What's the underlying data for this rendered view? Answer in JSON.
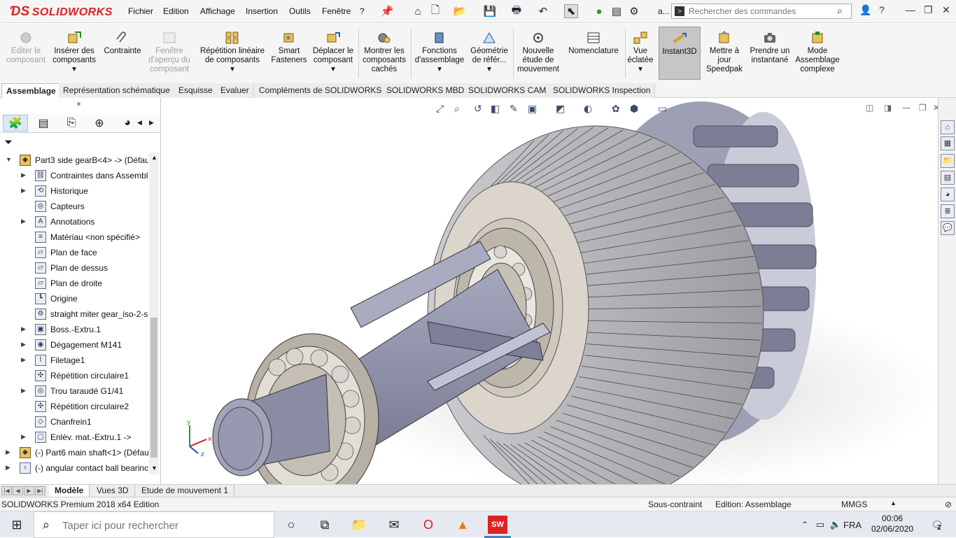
{
  "app": {
    "brand": "SOLIDWORKS",
    "menu": [
      "Fichier",
      "Edition",
      "Affichage",
      "Insertion",
      "Outils",
      "Fenêtre",
      "?"
    ],
    "overflow_label": "a...",
    "search_placeholder": "Rechercher des commandes"
  },
  "ribbon": {
    "buttons": [
      {
        "id": "edit-component",
        "label": "Editer le composant",
        "icon": "edit-component-icon",
        "enabled": false
      },
      {
        "id": "insert-components",
        "label": "Insérer des composants",
        "icon": "insert-components-icon",
        "enabled": true,
        "dropdown": true
      },
      {
        "id": "mate",
        "label": "Contrainte",
        "icon": "paperclip-icon",
        "enabled": true
      },
      {
        "id": "preview-window",
        "label": "Fenêtre d'aperçu du composant",
        "icon": "preview-window-icon",
        "enabled": false
      },
      {
        "id": "linear-pattern",
        "label": "Répétition linéaire de composants",
        "icon": "linear-pattern-icon",
        "enabled": true,
        "dropdown": true
      },
      {
        "id": "smart-fasteners",
        "label": "Smart Fasteners",
        "icon": "smart-fasteners-icon",
        "enabled": true
      },
      {
        "id": "move-component",
        "label": "Déplacer le composant",
        "icon": "move-component-icon",
        "enabled": true,
        "dropdown": true
      },
      {
        "id": "show-hidden",
        "label": "Montrer les composants cachés",
        "icon": "show-hidden-icon",
        "enabled": true
      },
      {
        "id": "assembly-features",
        "label": "Fonctions d'assemblage",
        "icon": "assembly-features-icon",
        "enabled": true,
        "dropdown": true
      },
      {
        "id": "reference-geometry",
        "label": "Géométrie de référ...",
        "icon": "reference-geometry-icon",
        "enabled": true,
        "dropdown": true
      },
      {
        "id": "new-motion-study",
        "label": "Nouvelle étude de mouvement",
        "icon": "motion-study-icon",
        "enabled": true
      },
      {
        "id": "bom",
        "label": "Nomenclature",
        "icon": "bom-icon",
        "enabled": true
      },
      {
        "id": "exploded-view",
        "label": "Vue éclatée",
        "icon": "exploded-view-icon",
        "enabled": true,
        "dropdown": true
      },
      {
        "id": "instant3d",
        "label": "Instant3D",
        "icon": "instant3d-icon",
        "enabled": true,
        "active": true
      },
      {
        "id": "update-speedpak",
        "label": "Mettre à jour Speedpak",
        "icon": "speedpak-icon",
        "enabled": true
      },
      {
        "id": "snapshot",
        "label": "Prendre un instantané",
        "icon": "camera-icon",
        "enabled": true
      },
      {
        "id": "large-assembly",
        "label": "Mode Assemblage complexe",
        "icon": "large-assembly-icon",
        "enabled": true
      }
    ]
  },
  "command_tabs": [
    {
      "label": "Assemblage",
      "active": true
    },
    {
      "label": "Représentation schématique"
    },
    {
      "label": "Esquisse"
    },
    {
      "label": "Evaluer"
    },
    {
      "label": "Compléments de SOLIDWORKS"
    },
    {
      "label": "SOLIDWORKS MBD"
    },
    {
      "label": "SOLIDWORKS CAM"
    },
    {
      "label": "SOLIDWORKS Inspection"
    }
  ],
  "feature_tree": [
    {
      "label": "Part3 side gearB<4> -> (Défau",
      "indent": 0,
      "expanded": true,
      "icon": "part-icon"
    },
    {
      "label": "Contraintes dans Assembl",
      "indent": 1,
      "expandable": true,
      "icon": "mates-icon"
    },
    {
      "label": "Historique",
      "indent": 1,
      "expandable": true,
      "icon": "history-icon"
    },
    {
      "label": "Capteurs",
      "indent": 1,
      "icon": "sensor-icon"
    },
    {
      "label": "Annotations",
      "indent": 1,
      "expandable": true,
      "icon": "annotations-icon"
    },
    {
      "label": "Matériau <non spécifié>",
      "indent": 1,
      "icon": "material-icon"
    },
    {
      "label": "Plan de face",
      "indent": 1,
      "icon": "plane-icon"
    },
    {
      "label": "Plan de dessus",
      "indent": 1,
      "icon": "plane-icon"
    },
    {
      "label": "Plan de droite",
      "indent": 1,
      "icon": "plane-icon"
    },
    {
      "label": "Origine",
      "indent": 1,
      "icon": "origin-icon"
    },
    {
      "label": "straight miter gear_iso-2-s",
      "indent": 1,
      "icon": "feature-icon"
    },
    {
      "label": "Boss.-Extru.1",
      "indent": 1,
      "expandable": true,
      "icon": "boss-extrude-icon"
    },
    {
      "label": "Dégagement M141",
      "indent": 1,
      "expandable": true,
      "icon": "hole-icon"
    },
    {
      "label": "Filetage1",
      "indent": 1,
      "expandable": true,
      "icon": "thread-icon"
    },
    {
      "label": "Répétition circulaire1",
      "indent": 1,
      "icon": "circular-pattern-icon"
    },
    {
      "label": "Trou taraudé G1/41",
      "indent": 1,
      "expandable": true,
      "icon": "tapped-hole-icon"
    },
    {
      "label": "Répétition circulaire2",
      "indent": 1,
      "icon": "circular-pattern-icon"
    },
    {
      "label": "Chanfrein1",
      "indent": 1,
      "icon": "chamfer-icon"
    },
    {
      "label": "Enlèv. mat.-Extru.1 ->",
      "indent": 1,
      "expandable": true,
      "icon": "cut-extrude-icon"
    },
    {
      "label": "(-) Part6 main shaft<1> (Défau",
      "indent": 0,
      "expandable": true,
      "icon": "part-icon"
    },
    {
      "label": "(-) angular contact ball bearinc",
      "indent": 0,
      "expandable": true,
      "icon": "bearing-icon"
    }
  ],
  "bottom_tabs": [
    {
      "label": "Modèle",
      "active": true
    },
    {
      "label": "Vues 3D"
    },
    {
      "label": "Etude de mouvement 1"
    }
  ],
  "status": {
    "product": "SOLIDWORKS Premium 2018 x64 Edition",
    "constraint": "Sous-contraint",
    "mode": "Edition: Assemblage",
    "units": "MMGS"
  },
  "taskbar": {
    "search_placeholder": "Taper ici pour rechercher",
    "language": "FRA",
    "time": "00:06",
    "date": "02/06/2020",
    "notification_count": "2"
  },
  "colors": {
    "solidworks_red": "#d22222",
    "accent": "#4a7fc0",
    "gear": "#b8b8bc",
    "shaft": "#8d8fa6"
  }
}
